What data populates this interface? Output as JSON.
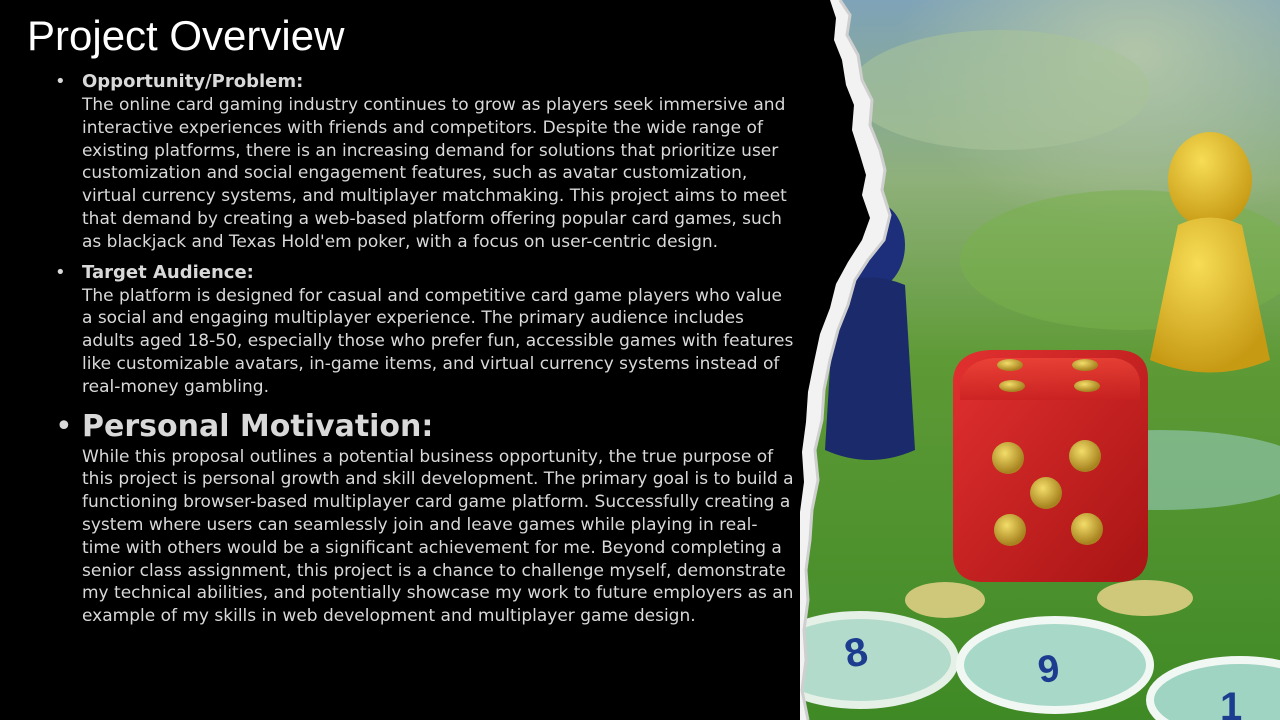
{
  "slide": {
    "title": "Project Overview",
    "bullets": [
      {
        "heading": "Opportunity/Problem:",
        "text": "The online card gaming industry continues to grow as players seek immersive and interactive experiences with friends and competitors. Despite the wide range of existing platforms, there is an increasing demand for solutions that prioritize user customization and social engagement features, such as avatar customization, virtual currency systems, and multiplayer matchmaking. This project aims to meet that demand by creating a web-based platform offering popular card games, such as blackjack and Texas Hold'em poker, with a focus on user-centric design."
      },
      {
        "heading": "Target Audience:",
        "text": "The platform is designed for casual and competitive card game players who value a social and engaging multiplayer experience. The primary audience includes adults aged 18-50, especially those who prefer fun, accessible games with features like customizable avatars, in-game items, and virtual currency systems instead of real-money gambling."
      },
      {
        "heading": "Personal Motivation:",
        "text": "While this proposal outlines a potential business opportunity, the true purpose of this project is personal growth and skill development. The primary goal is to build a functioning browser-based multiplayer card game platform. Successfully creating a system where users can seamlessly join and leave games while playing in real-time with others would be a significant achievement for me. Beyond completing a senior class assignment, this project is a chance to challenge myself, demonstrate my technical abilities, and potentially showcase my work to future employers as an example of my skills in web development and multiplayer game design."
      }
    ],
    "bullet_symbol": "•",
    "photo": {
      "board_numbers": [
        "8",
        "9",
        "1"
      ],
      "colors": {
        "background": "#000000",
        "text": "#d9d9d9",
        "die": "#d21e1e",
        "pip": "#c9a82a",
        "pawn_yellow": "#e6c22a",
        "pawn_blue": "#1d2f7a",
        "board_green": "#4aa02c"
      }
    }
  }
}
